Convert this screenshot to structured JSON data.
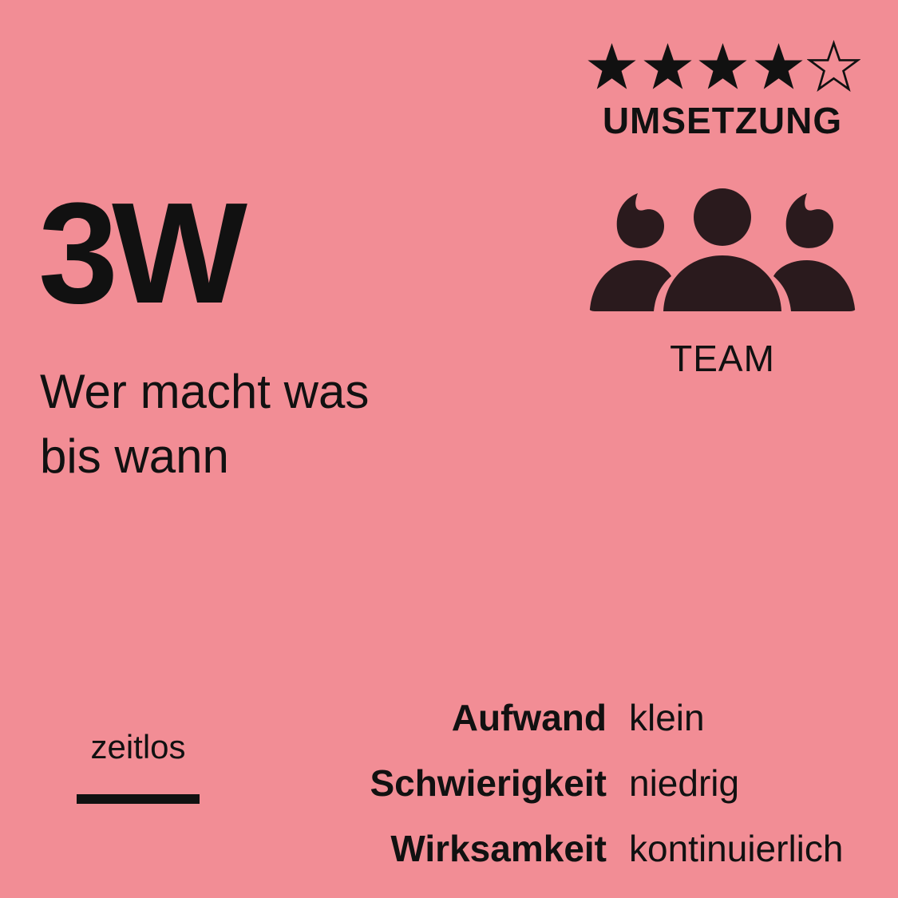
{
  "rating": {
    "value": 4,
    "max": 5,
    "filled_symbol": "★",
    "empty_symbol": "☆",
    "label": "UMSETZUNG"
  },
  "method": {
    "title": "3W",
    "subtitle_lines": [
      "Wer macht was",
      "bis wann"
    ]
  },
  "team": {
    "icon": "team-icon",
    "label": "TEAM"
  },
  "timeless": {
    "label": "zeitlos"
  },
  "facts": [
    {
      "label": "Aufwand",
      "value": "klein"
    },
    {
      "label": "Schwierigkeit",
      "value": "niedrig"
    },
    {
      "label": "Wirksamkeit",
      "value": "kontinuierlich"
    }
  ],
  "colors": {
    "background": "#f28d95",
    "text": "#111111"
  }
}
